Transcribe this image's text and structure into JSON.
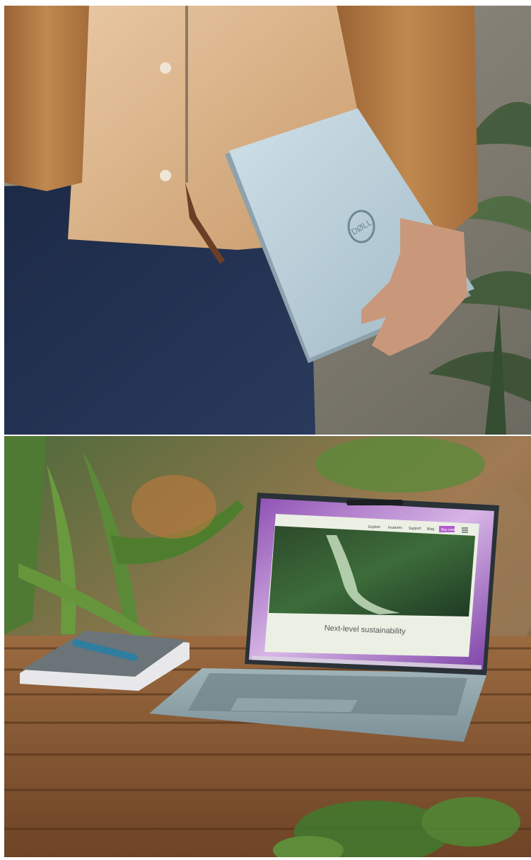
{
  "photos": [
    {
      "id": "person-holding-laptop"
    },
    {
      "id": "laptop-on-table"
    }
  ],
  "laptop_screen": {
    "nav": [
      "Explore",
      "Features",
      "Support",
      "Blog",
      "Buy now"
    ],
    "headline": "Next-level sustainability"
  },
  "colors": {
    "jacket": "#b07a45",
    "jeans": "#1f2f4f",
    "laptop_lid": "#b9cfd9",
    "table_wood": "#8a5a33",
    "screen_purple": "#a770c8"
  }
}
